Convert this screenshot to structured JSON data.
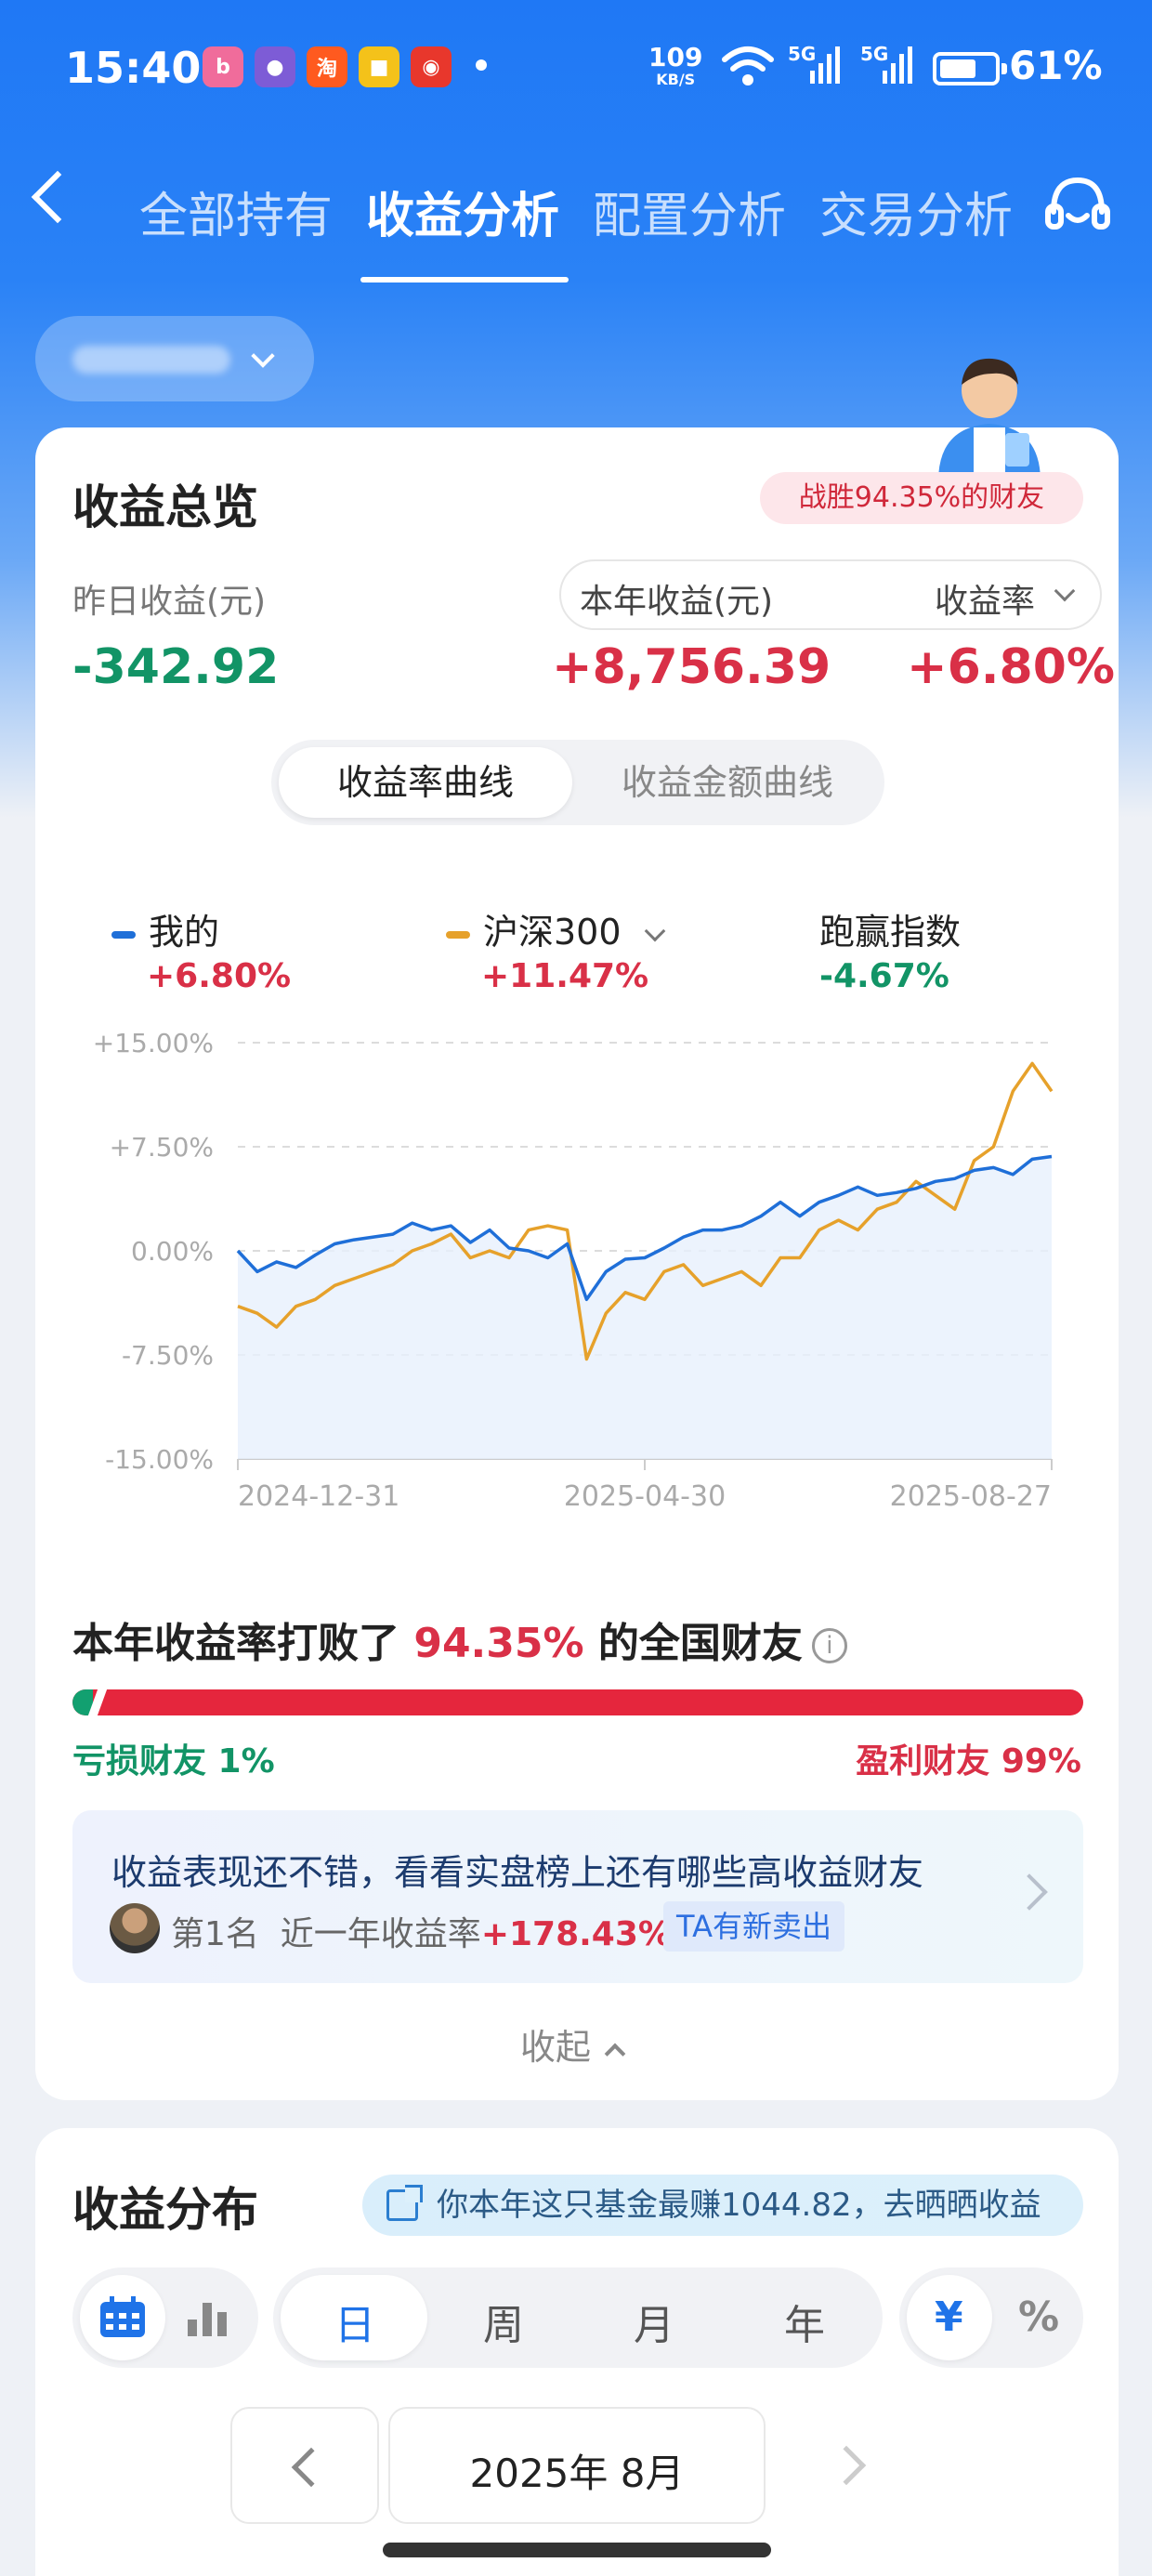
{
  "status": {
    "time": "15:40",
    "net_speed": "109",
    "net_unit": "KB/S",
    "signal1": "5G",
    "signal2": "5G",
    "battery": "61%"
  },
  "nav": {
    "tabs": [
      "全部持有",
      "收益分析",
      "配置分析",
      "交易分析"
    ],
    "active_tab": "收益分析"
  },
  "overview": {
    "title": "收益总览",
    "rank_badge": "战胜94.35%的财友",
    "yesterday_label": "昨日收益(元)",
    "yesterday_value": "-342.92",
    "year_label": "本年收益(元)",
    "rate_label": "收益率",
    "year_value": "+8,756.39",
    "rate_value": "+6.80%",
    "seg_rate": "收益率曲线",
    "seg_amount": "收益金额曲线"
  },
  "legend": [
    {
      "name": "我的",
      "value": "+6.80%",
      "color": "#1f6fd8"
    },
    {
      "name": "沪深300",
      "value": "+11.47%",
      "color": "#e6a12b"
    },
    {
      "name": "跑赢指数",
      "value": "-4.67%"
    }
  ],
  "chart_data": {
    "type": "line",
    "x_ticks": [
      "2024-12-31",
      "2025-04-30",
      "2025-08-27"
    ],
    "y_ticks": [
      "+15.00%",
      "+7.50%",
      "0.00%",
      "-7.50%",
      "-15.00%"
    ],
    "ylim": [
      -15,
      15
    ],
    "series": [
      {
        "name": "我的",
        "color": "#1f6fd8",
        "values": [
          0,
          -1.5,
          -0.8,
          -1.2,
          -0.3,
          0.5,
          0.8,
          1.0,
          1.2,
          2.0,
          1.5,
          1.8,
          0.6,
          1.5,
          0.2,
          0,
          -0.5,
          0.5,
          -3.5,
          -1.5,
          -0.6,
          -0.5,
          0.2,
          1.0,
          1.5,
          1.5,
          1.8,
          2.5,
          3.5,
          2.5,
          3.5,
          4.0,
          4.6,
          4.0,
          4.2,
          4.5,
          5.0,
          5.2,
          5.8,
          6.0,
          5.5,
          6.6,
          6.8
        ]
      },
      {
        "name": "沪深300",
        "color": "#e6a12b",
        "values": [
          -4,
          -4.5,
          -5.5,
          -4,
          -3.5,
          -2.5,
          -2,
          -1.5,
          -1,
          0,
          0.5,
          1.2,
          -0.5,
          0,
          -0.5,
          1.5,
          1.8,
          1.5,
          -7.8,
          -4.5,
          -3,
          -3.5,
          -1.5,
          -1,
          -2.5,
          -2,
          -1.5,
          -2.5,
          -0.5,
          -0.5,
          1.5,
          2.2,
          1.5,
          3.0,
          3.5,
          5,
          4.0,
          3.0,
          6.5,
          7.5,
          11.5,
          13.5,
          11.5
        ]
      }
    ]
  },
  "beat": {
    "prefix": "本年收益率打败了",
    "pct": "94.35%",
    "suffix": "的全国财友",
    "info_icon": "i",
    "loss": "亏损财友 1%",
    "profit": "盈利财友 99%",
    "loss_fraction": 0.01
  },
  "promo": {
    "title": "收益表现还不错，看看实盘榜上还有哪些高收益财友",
    "rank": "第1名",
    "desc": "近一年收益率",
    "rate": "+178.43%",
    "tag": "TA有新卖出"
  },
  "collapse": "收起",
  "distribution": {
    "title": "收益分布",
    "share": "你本年这只基金最赚1044.82，去晒晒收益",
    "periods": [
      "日",
      "周",
      "月",
      "年"
    ],
    "active_period": "日",
    "unit_yen": "¥",
    "unit_pct": "%",
    "month": "2025年 8月"
  }
}
